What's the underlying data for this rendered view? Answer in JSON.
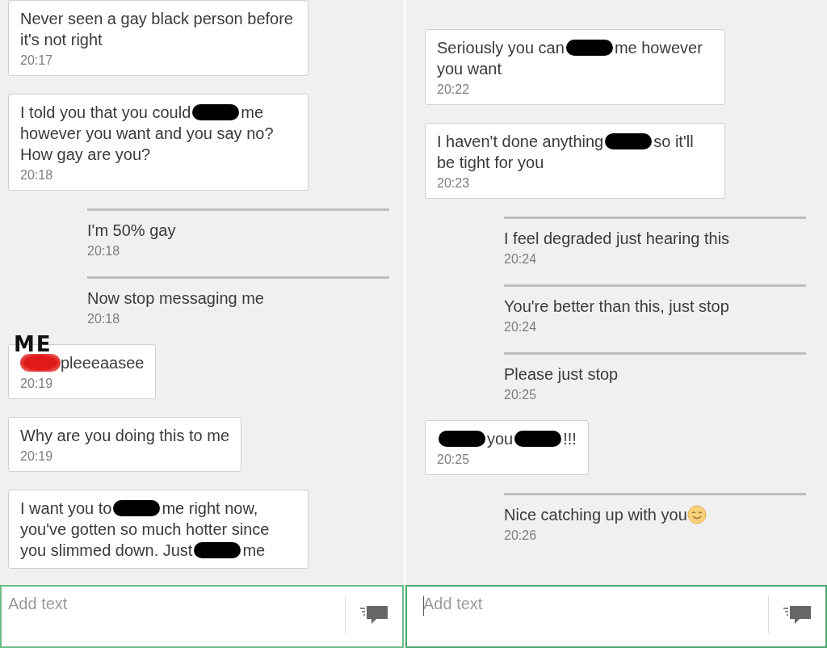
{
  "panels": [
    {
      "messages": [
        {
          "kind": "received",
          "parts": [
            {
              "kind": "text",
              "text": "Never seen a gay black person before it's not right"
            }
          ],
          "time": "20:17"
        },
        {
          "kind": "received",
          "parts": [
            {
              "kind": "text",
              "text": "I told you that you could"
            },
            {
              "kind": "redaction"
            },
            {
              "kind": "text",
              "text": "me however you want and you say no? How gay are you?"
            }
          ],
          "time": "20:18"
        },
        {
          "kind": "sent",
          "parts": [
            {
              "kind": "text",
              "text": "I'm 50% gay"
            }
          ],
          "time": "20:18"
        },
        {
          "kind": "sent",
          "parts": [
            {
              "kind": "text",
              "text": "Now stop messaging me"
            }
          ],
          "time": "20:18"
        },
        {
          "kind": "received",
          "annotation": "ME",
          "parts": [
            {
              "kind": "scribble"
            },
            {
              "kind": "text",
              "text": "pleeeaasee"
            }
          ],
          "time": "20:19"
        },
        {
          "kind": "received",
          "parts": [
            {
              "kind": "text",
              "text": "Why are you doing this to me"
            }
          ],
          "time": "20:19"
        },
        {
          "kind": "received",
          "parts": [
            {
              "kind": "text",
              "text": "I want you to"
            },
            {
              "kind": "redaction"
            },
            {
              "kind": "text",
              "text": "me right now, you've gotten so much hotter since you slimmed down. Just"
            },
            {
              "kind": "redaction"
            },
            {
              "kind": "text",
              "text": "me"
            }
          ]
        }
      ],
      "composer": {
        "placeholder": "Add text",
        "focused": false
      }
    },
    {
      "messages": [
        {
          "kind": "received",
          "parts": [
            {
              "kind": "text",
              "text": "Seriously you can"
            },
            {
              "kind": "redaction"
            },
            {
              "kind": "text",
              "text": "me however you want"
            }
          ],
          "time": "20:22"
        },
        {
          "kind": "received",
          "parts": [
            {
              "kind": "text",
              "text": "I haven't done anything"
            },
            {
              "kind": "redaction"
            },
            {
              "kind": "text",
              "text": "so it'll be tight for you"
            }
          ],
          "time": "20:23"
        },
        {
          "kind": "sent",
          "parts": [
            {
              "kind": "text",
              "text": "I feel degraded just hearing this"
            }
          ],
          "time": "20:24"
        },
        {
          "kind": "sent",
          "parts": [
            {
              "kind": "text",
              "text": "You're better than this, just stop"
            }
          ],
          "time": "20:24"
        },
        {
          "kind": "sent",
          "parts": [
            {
              "kind": "text",
              "text": "Please just stop"
            }
          ],
          "time": "20:25"
        },
        {
          "kind": "received",
          "parts": [
            {
              "kind": "redaction"
            },
            {
              "kind": "text",
              "text": "you"
            },
            {
              "kind": "redaction"
            },
            {
              "kind": "text",
              "text": "!!!"
            }
          ],
          "time": "20:25"
        },
        {
          "kind": "sent",
          "parts": [
            {
              "kind": "text",
              "text": "Nice catching up with you"
            },
            {
              "kind": "smiley"
            }
          ],
          "time": "20:26"
        }
      ],
      "composer": {
        "placeholder": "Add text",
        "focused": true
      }
    }
  ]
}
